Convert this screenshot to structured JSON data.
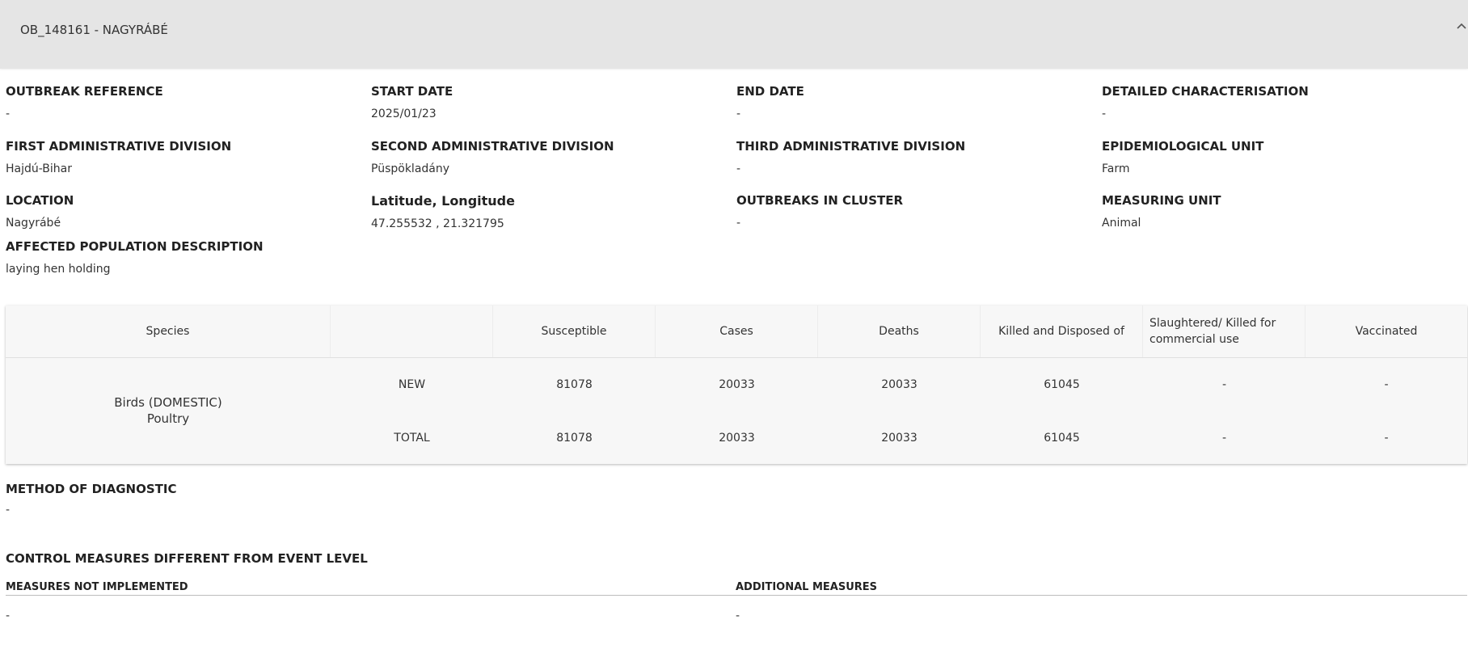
{
  "header": {
    "title": "OB_148161 - NAGYRÁBÉ",
    "collapse_icon": "chevron-up-icon"
  },
  "info": [
    {
      "label": "OUTBREAK REFERENCE",
      "value": "-"
    },
    {
      "label": "START DATE",
      "value": "2025/01/23"
    },
    {
      "label": "END DATE",
      "value": "-"
    },
    {
      "label": "DETAILED CHARACTERISATION",
      "value": "-"
    },
    {
      "label": "FIRST ADMINISTRATIVE DIVISION",
      "value": "Hajdú-Bihar"
    },
    {
      "label": "SECOND ADMINISTRATIVE DIVISION",
      "value": "Püspökladány"
    },
    {
      "label": "THIRD ADMINISTRATIVE DIVISION",
      "value": "-"
    },
    {
      "label": "EPIDEMIOLOGICAL UNIT",
      "value": "Farm"
    },
    {
      "label": "LOCATION",
      "value": "Nagyrábé"
    },
    {
      "label": "Latitude, Longitude",
      "value": "47.255532 , 21.321795"
    },
    {
      "label": "OUTBREAKS IN CLUSTER",
      "value": "-"
    },
    {
      "label": "MEASURING UNIT",
      "value": "Animal"
    },
    {
      "label": "AFFECTED POPULATION DESCRIPTION",
      "value": "laying hen holding"
    }
  ],
  "table": {
    "headers": {
      "species": "Species",
      "susceptible": "Susceptible",
      "cases": "Cases",
      "deaths": "Deaths",
      "killed": "Killed and Disposed of",
      "slaughtered": "Slaughtered/ Killed for commercial use",
      "vaccinated": "Vaccinated"
    },
    "species_line1": "Birds (DOMESTIC)",
    "species_line2": "Poultry",
    "rows": [
      {
        "type": "NEW",
        "susceptible": "81078",
        "cases": "20033",
        "deaths": "20033",
        "killed": "61045",
        "slaughtered": "-",
        "vaccinated": "-"
      },
      {
        "type": "TOTAL",
        "susceptible": "81078",
        "cases": "20033",
        "deaths": "20033",
        "killed": "61045",
        "slaughtered": "-",
        "vaccinated": "-"
      }
    ]
  },
  "diagnostic": {
    "label": "METHOD OF DIAGNOSTIC",
    "value": "-"
  },
  "control": {
    "title": "CONTROL MEASURES DIFFERENT FROM EVENT LEVEL",
    "not_implemented_label": "MEASURES NOT IMPLEMENTED",
    "not_implemented_value": "-",
    "additional_label": "ADDITIONAL MEASURES",
    "additional_value": "-"
  }
}
